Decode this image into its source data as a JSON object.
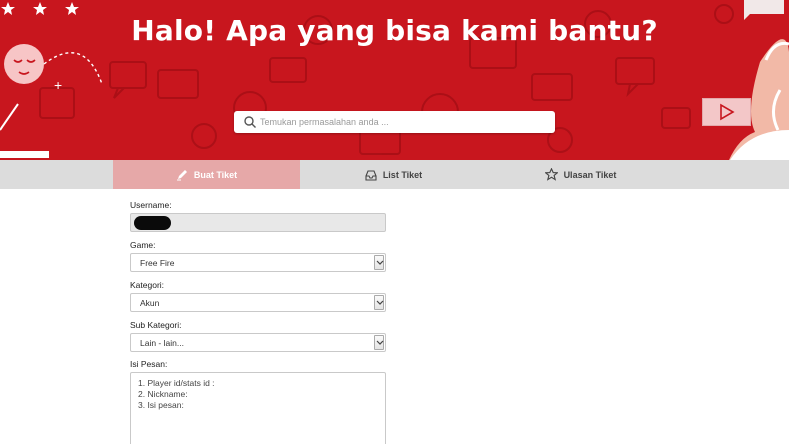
{
  "hero": {
    "title": "Halo! Apa yang bisa kami bantu?",
    "search_placeholder": "Temukan permasalahan anda ...",
    "bg_color": "#c8161e"
  },
  "tabs": [
    {
      "label": "Buat Tiket",
      "icon": "pencil-icon",
      "active": true
    },
    {
      "label": "List Tiket",
      "icon": "inbox-icon",
      "active": false
    },
    {
      "label": "Ulasan Tiket",
      "icon": "star-icon",
      "active": false
    }
  ],
  "form": {
    "username": {
      "label": "Username:",
      "value": ""
    },
    "game": {
      "label": "Game:",
      "value": "Free Fire"
    },
    "kategori": {
      "label": "Kategori:",
      "value": "Akun"
    },
    "sub_kategori": {
      "label": "Sub Kategori:",
      "value": "Lain - lain..."
    },
    "isi_pesan": {
      "label": "Isi Pesan:",
      "lines": [
        "1. Player id/stats id :",
        "2. Nickname:",
        "3. Isi pesan:"
      ]
    }
  },
  "colors": {
    "accent": "#c8161e",
    "tab_active": "#e6a8a8",
    "tab_bar": "#dcdcdc"
  }
}
